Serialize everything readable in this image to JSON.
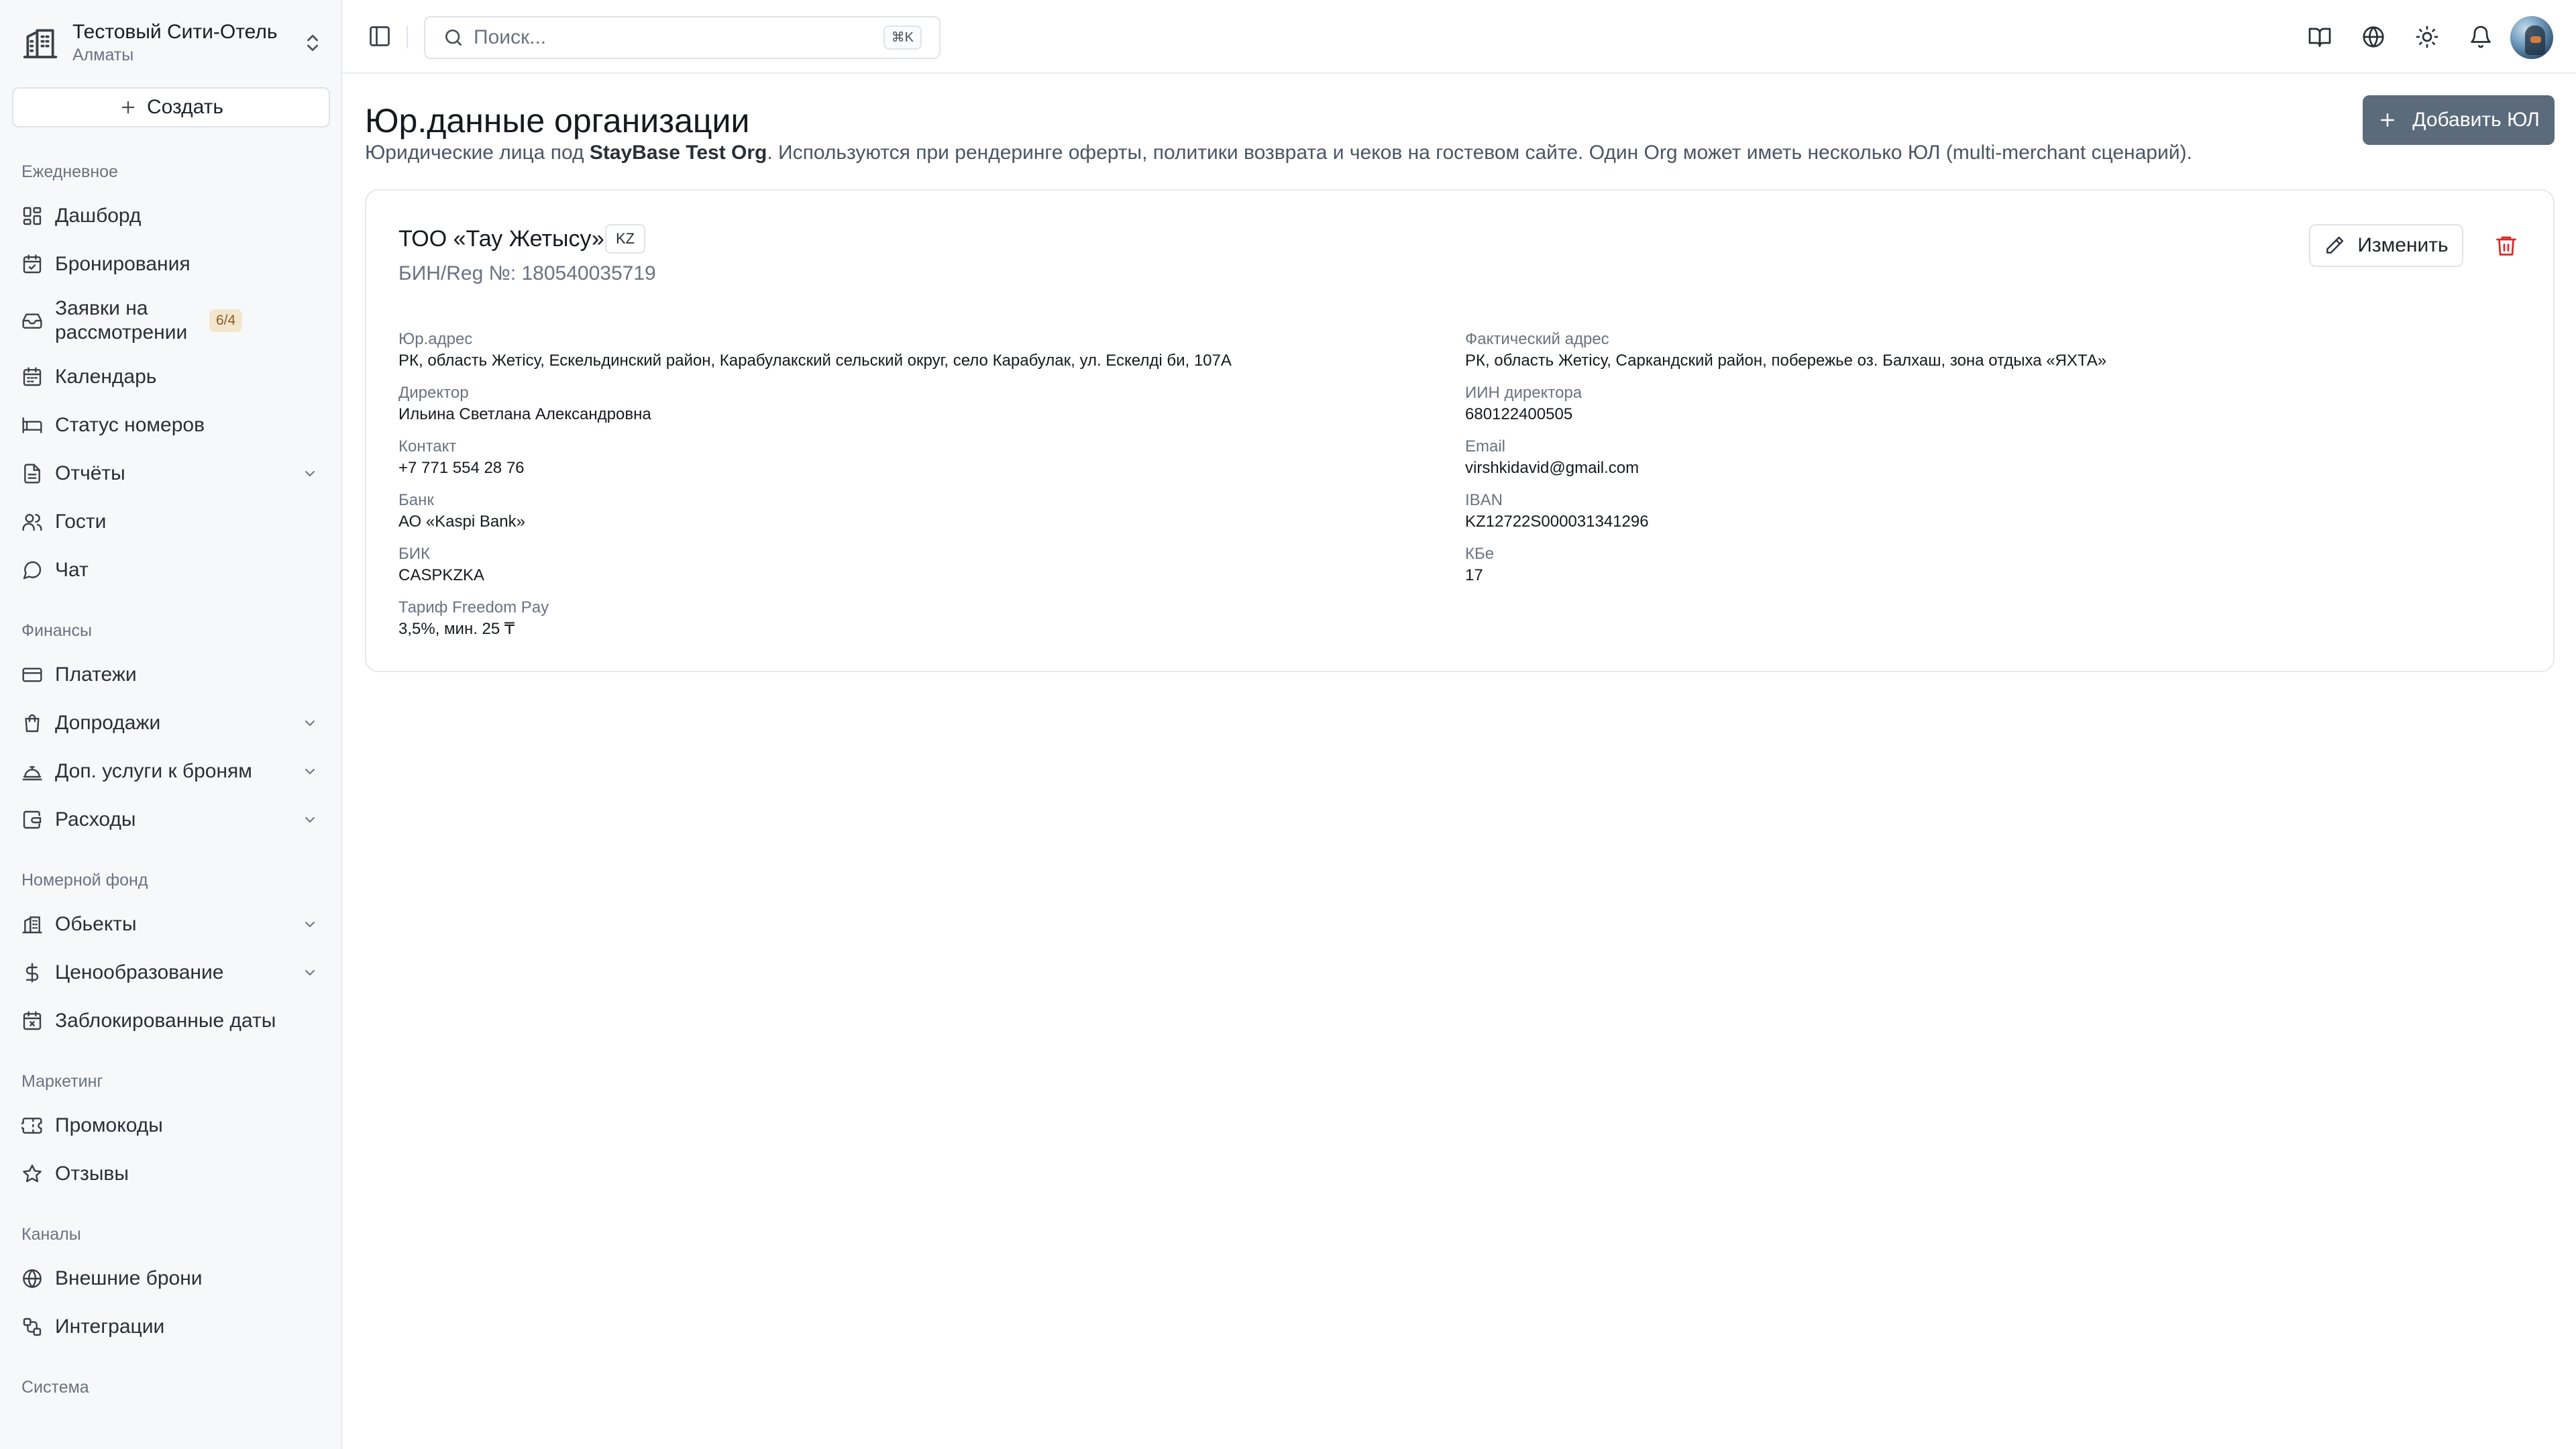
{
  "sidebar": {
    "org_name": "Тестовый Сити-Отель",
    "org_city": "Алматы",
    "create_label": "Создать",
    "sections": {
      "daily": "Ежедневное",
      "finance": "Финансы",
      "rooms": "Номерной фонд",
      "marketing": "Маркетинг",
      "channels": "Каналы",
      "system": "Система"
    },
    "items": {
      "dashboard": "Дашборд",
      "bookings": "Бронирования",
      "requests": "Заявки на рассмотрении",
      "requests_badge": "6/4",
      "calendar": "Календарь",
      "room_status": "Статус номеров",
      "reports": "Отчёты",
      "guests": "Гости",
      "chat": "Чат",
      "payments": "Платежи",
      "upsells": "Допродажи",
      "addons": "Доп. услуги к броням",
      "expenses": "Расходы",
      "properties": "Обьекты",
      "pricing": "Ценообразование",
      "blocked_dates": "Заблокированные даты",
      "promocodes": "Промокоды",
      "reviews": "Отзывы",
      "external_bookings": "Внешние брони",
      "integrations": "Интеграции"
    }
  },
  "topbar": {
    "search_placeholder": "Поиск...",
    "search_shortcut": "⌘K",
    "icons": [
      "sidebar-toggle-icon",
      "search-icon",
      "book-icon",
      "globe-icon",
      "sun-icon",
      "bell-icon",
      "avatar"
    ]
  },
  "main": {
    "title": "Юр.данные организации",
    "subtitle_prefix": "Юридические лица под ",
    "subtitle_org": "StayBase Test Org",
    "subtitle_suffix": ". Используются при рендеринге оферты, политики возврата и чеков на гостевом сайте. Один Org может иметь несколько ЮЛ (multi-merchant сценарий).",
    "add_button": "Добавить ЮЛ"
  },
  "entity": {
    "name": "ТОО «Тау Жетысу»",
    "country": "KZ",
    "reg_number": "БИН/Reg №: 180540035719",
    "edit_button": "Изменить",
    "fields": {
      "legal_address_label": "Юр.адрес",
      "legal_address": "РК, область Жетісу, Ескельдинский район, Карабулакский сельский округ, село Карабулак, ул. Ескелді би, 107А",
      "actual_address_label": "Фактический адрес",
      "actual_address": "РК, область Жетісу, Саркандский район, побережье оз. Балхаш, зона отдыха «ЯХТА»",
      "director_label": "Директор",
      "director": "Ильина Светлана Александровна",
      "director_iin_label": "ИИН директора",
      "director_iin": "680122400505",
      "contact_label": "Контакт",
      "contact": "+7 771 554 28 76",
      "email_label": "Email",
      "email": "virshkidavid@gmail.com",
      "bank_label": "Банк",
      "bank": "АО «Kaspi Bank»",
      "iban_label": "IBAN",
      "iban": "KZ12722S000031341296",
      "bik_label": "БИК",
      "bik": "CASPKZKA",
      "kbe_label": "КБе",
      "kbe": "17",
      "tariff_label": "Тариф Freedom Pay",
      "tariff": "3,5%, мин. 25 ₸"
    }
  },
  "colors": {
    "primary_button": "#5b6b7b",
    "danger": "#dc2626",
    "badge_bg": "#f3e6cf",
    "badge_text": "#8a5a1f"
  }
}
